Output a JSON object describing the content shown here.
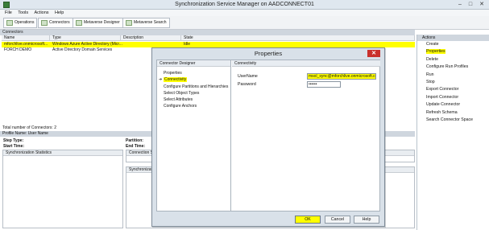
{
  "window": {
    "title": "Synchronization Service Manager on AADCONNECT01",
    "min": "–",
    "max": "□",
    "close": "✕"
  },
  "menu": [
    "File",
    "Tools",
    "Actions",
    "Help"
  ],
  "toolbar": {
    "operations": "Operations",
    "connectors": "Connectors",
    "metaverse_designer": "Metaverse Designer",
    "metaverse_search": "Metaverse Search"
  },
  "connectors": {
    "section_label": "Connectors",
    "columns": [
      "Name",
      "Type",
      "Description",
      "State"
    ],
    "rows": [
      {
        "name": "mforchlive.onmicrosoft...",
        "type": "Windows Azure Active Directory (Micr...",
        "description": "",
        "state": "Idle"
      },
      {
        "name": "FORCH DEMO",
        "type": "Active Directory Domain Services",
        "description": "",
        "state": "Idle"
      }
    ],
    "total": "Total number of Connectors: 2"
  },
  "profile": {
    "header": "Profile Name:    User Name",
    "step_type": "Step Type:",
    "start_time": "Start Time:",
    "partition": "Partition:",
    "end_time": "End Time:",
    "sync_stats": "Synchronization Statistics",
    "connection_status": "Connection St",
    "synchronization": "Synchronizati"
  },
  "actions": {
    "header": "Actions",
    "items": [
      "Create",
      "Properties",
      "Delete",
      "Configure Run Profiles",
      "Run",
      "Stop",
      "Export Connector",
      "Import Connector",
      "Update Connector",
      "Refresh Schema",
      "Search Connector Space"
    ]
  },
  "dialog": {
    "title": "Properties",
    "close": "✕",
    "designer_header": "Connector Designer",
    "designer_items": [
      "Properties",
      "Connectivity",
      "Configure Partitions and Hierarchies",
      "Select Object Types",
      "Select Attributes",
      "Configure Anchors"
    ],
    "conn_header": "Connectivity",
    "username_label": "UserName",
    "username_value": "msol_sync@mforchlive.onmicrosoft.com",
    "password_label": "Password",
    "password_value": "••••••",
    "ok": "OK",
    "cancel": "Cancel",
    "help": "Help"
  }
}
